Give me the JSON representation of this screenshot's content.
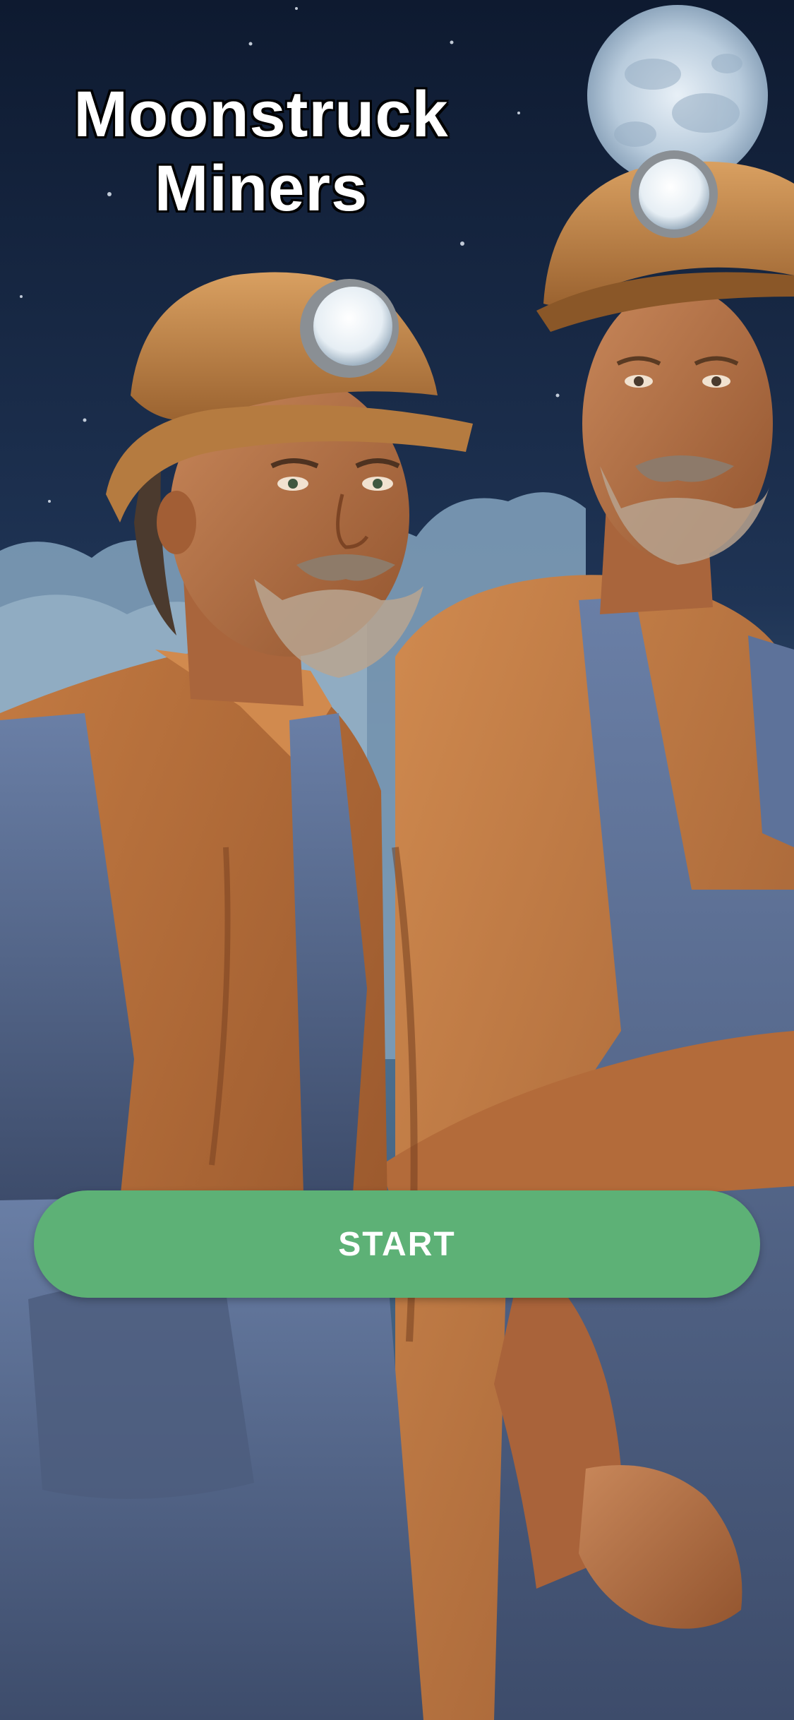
{
  "app": {
    "title_line1": "Moonstruck",
    "title_line2": "Miners"
  },
  "actions": {
    "start_label": "START"
  },
  "colors": {
    "start_button": "#5db176",
    "sky": "#1b2b45",
    "shirt": "#b8703d",
    "overalls": "#5a6f95",
    "helmet": "#c98a45"
  }
}
